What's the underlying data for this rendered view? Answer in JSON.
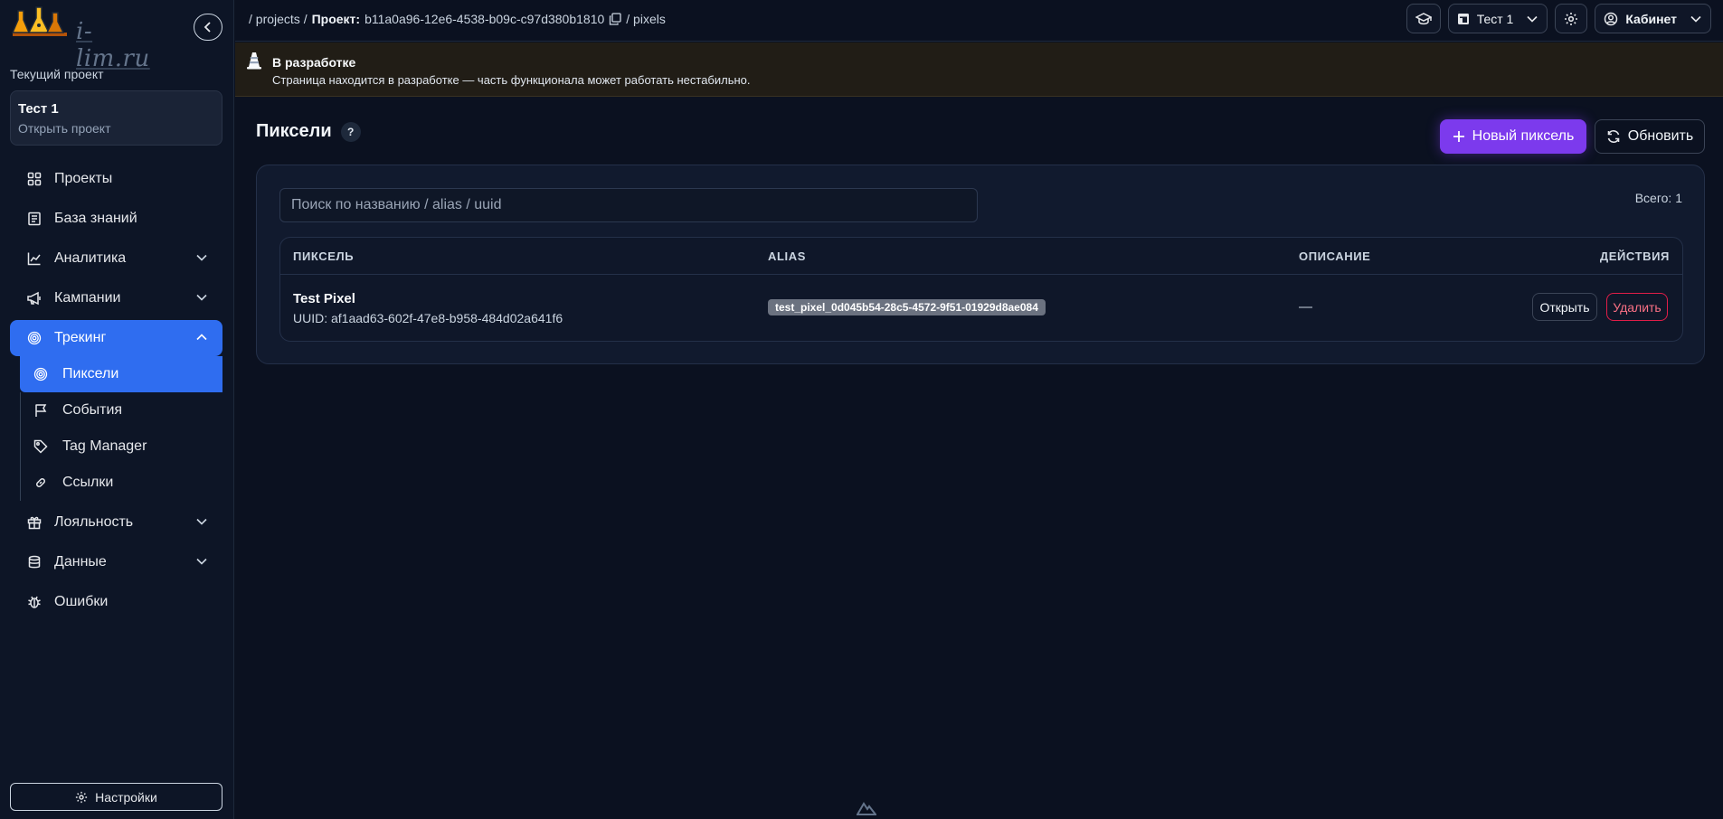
{
  "brand": {
    "logo_text": "i-lim.ru"
  },
  "sidebar": {
    "current_project_label": "Текущий проект",
    "project_name": "Тест 1",
    "open_project": "Открыть проект",
    "items": [
      {
        "label": "Проекты",
        "icon": "grid-icon"
      },
      {
        "label": "База знаний",
        "icon": "book-icon"
      },
      {
        "label": "Аналитика",
        "icon": "chart-line-icon"
      },
      {
        "label": "Кампании",
        "icon": "megaphone-icon"
      },
      {
        "label": "Трекинг",
        "icon": "fingerprint-icon"
      },
      {
        "label": "Лояльность",
        "icon": "gift-icon"
      },
      {
        "label": "Данные",
        "icon": "database-icon"
      },
      {
        "label": "Ошибки",
        "icon": "bug-icon"
      }
    ],
    "sub_items": [
      {
        "label": "Пиксели",
        "icon": "fingerprint-icon"
      },
      {
        "label": "События",
        "icon": "flag-icon"
      },
      {
        "label": "Tag Manager",
        "icon": "tag-icon"
      },
      {
        "label": "Ссылки",
        "icon": "link-icon"
      }
    ],
    "settings_label": "Настройки"
  },
  "topbar": {
    "crumb_projects": "/ projects /",
    "crumb_project_label": "Проект:",
    "crumb_project_id": "b11a0a96-12e6-4538-b09c-c97d380b1810",
    "crumb_pixels": "/ pixels",
    "project_select": "Тест 1",
    "cabinet": "Кабинет"
  },
  "banner": {
    "title": "В разработке",
    "text": "Страница находится в разработке — часть функционала может работать нестабильно."
  },
  "main": {
    "title": "Пиксели",
    "help": "?",
    "new_button": "Новый пиксель",
    "refresh_button": "Обновить",
    "search_placeholder": "Поиск по названию / alias / uuid",
    "total": "Всего: 1",
    "columns": [
      "ПИКСЕЛЬ",
      "ALIAS",
      "ОПИСАНИЕ",
      "ДЕЙСТВИЯ"
    ],
    "rows": [
      {
        "name": "Test Pixel",
        "uuid": "UUID: af1aad63-602f-47e8-b958-484d02a641f6",
        "alias": "test_pixel_0d045b54-28c5-4572-9f51-01929d8ae084",
        "description": "—",
        "open": "Открыть",
        "delete": "Удалить"
      }
    ]
  },
  "colors": {
    "background": "#0b1120",
    "accent_blue": "#2f6df0",
    "accent_purple": "#7c3aed",
    "danger": "#e11d48"
  }
}
